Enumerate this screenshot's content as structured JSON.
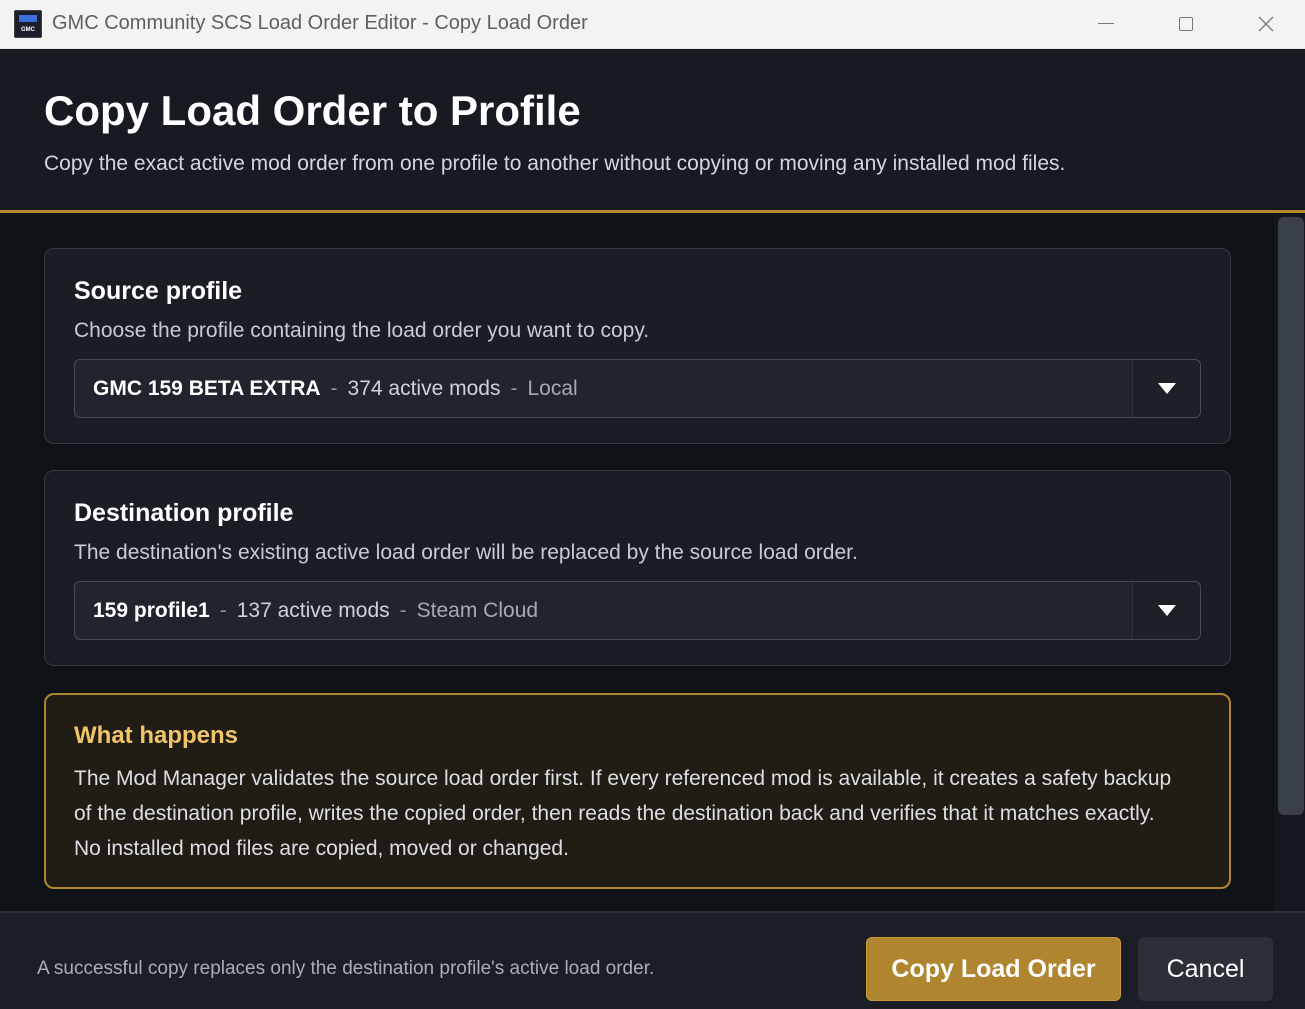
{
  "window": {
    "title": "GMC Community SCS Load Order Editor - Copy Load Order",
    "icon_label": "GMC"
  },
  "header": {
    "title": "Copy Load Order to Profile",
    "subtitle": "Copy the exact active mod order from one profile to another without copying or moving any installed mod files."
  },
  "source": {
    "title": "Source profile",
    "description": "Choose the profile containing the load order you want to copy.",
    "selected": {
      "name": "GMC 159 BETA EXTRA",
      "separator": "-",
      "mods": "374 active mods",
      "location": "Local"
    }
  },
  "destination": {
    "title": "Destination profile",
    "description": "The destination's existing active load order will be replaced by the source load order.",
    "selected": {
      "name": "159 profile1",
      "separator": "-",
      "mods": "137 active mods",
      "location": "Steam Cloud"
    }
  },
  "info": {
    "title": "What happens",
    "text": "The Mod Manager validates the source load order first. If every referenced mod is available, it creates a safety backup of the destination profile, writes the copied order, then reads the destination back and verifies that it matches exactly. No installed mod files are copied, moved or changed."
  },
  "footer": {
    "note": "A successful copy replaces only the destination profile's active load order.",
    "primary_label": "Copy Load Order",
    "cancel_label": "Cancel"
  },
  "colors": {
    "accent": "#b08530",
    "info_title": "#f0c46a",
    "background": "#0f1318"
  },
  "icons": {
    "app": "gmc-app-icon",
    "minimize": "minimize-icon",
    "maximize": "maximize-icon",
    "close": "close-icon",
    "dropdown": "chevron-down-icon"
  }
}
